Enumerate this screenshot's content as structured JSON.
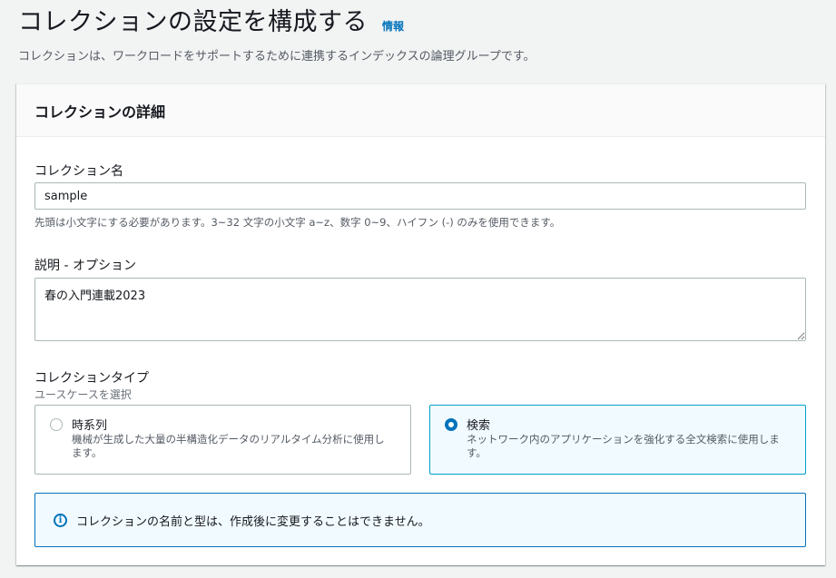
{
  "header": {
    "title": "コレクションの設定を構成する",
    "info_link": "情報",
    "description": "コレクションは、ワークロードをサポートするために連携するインデックスの論理グループです。"
  },
  "card": {
    "title": "コレクションの詳細",
    "name_field": {
      "label": "コレクション名",
      "value": "sample",
      "hint": "先頭は小文字にする必要があります。3~32 文字の小文字 a~z、数字 0~9、ハイフン (-) のみを使用できます。"
    },
    "description_field": {
      "label": "説明 - オプション",
      "value": "春の入門連載2023"
    },
    "type_field": {
      "label": "コレクションタイプ",
      "sublabel": "ユースケースを選択",
      "options": [
        {
          "title": "時系列",
          "description": "機械が生成した大量の半構造化データのリアルタイム分析に使用します。",
          "selected": false
        },
        {
          "title": "検索",
          "description": "ネットワーク内のアプリケーションを強化する全文検索に使用します。",
          "selected": true
        }
      ]
    },
    "info_alert": {
      "icon": "info-icon",
      "text": "コレクションの名前と型は、作成後に変更することはできません。"
    }
  },
  "colors": {
    "accent": "#0073bb",
    "selected_border": "#00a1c9",
    "page_bg": "#f2f3f3"
  }
}
